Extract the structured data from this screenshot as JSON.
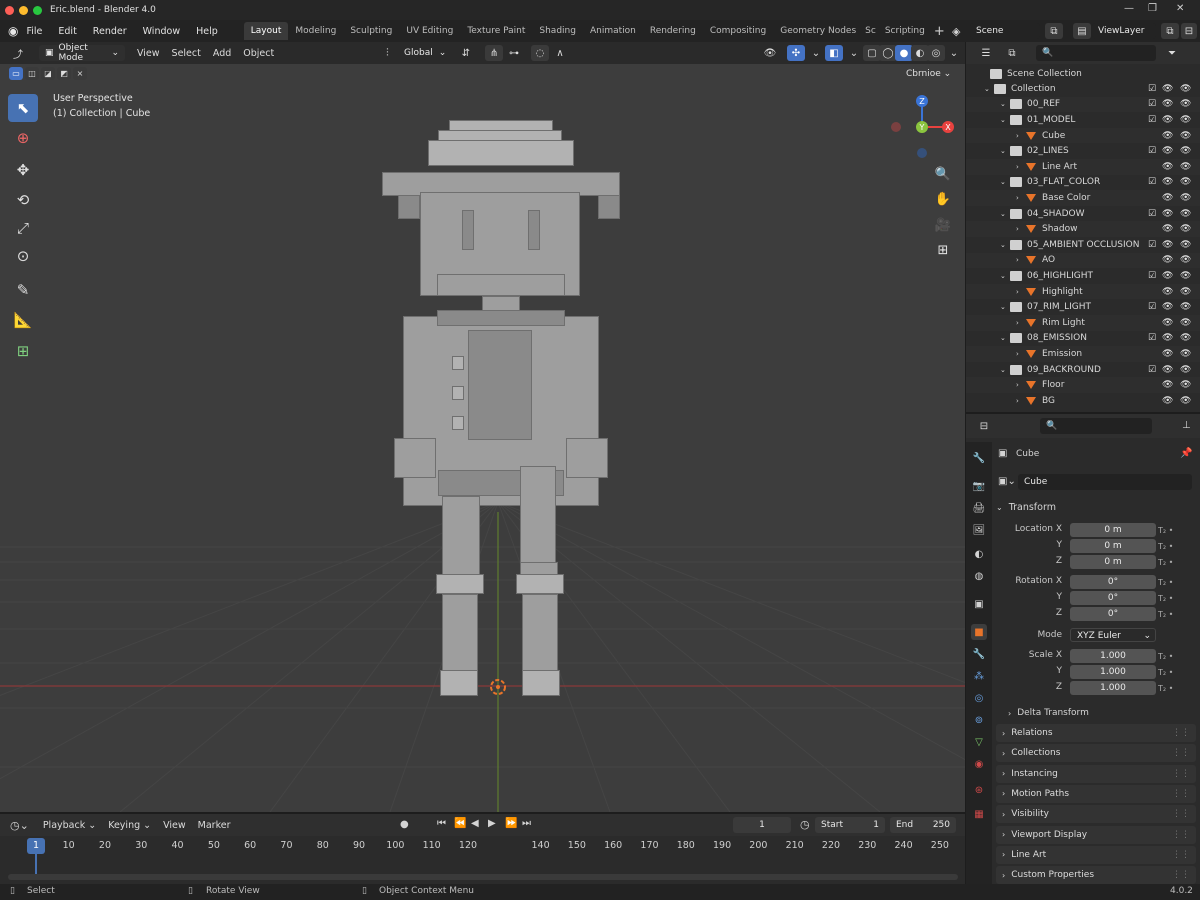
{
  "app": {
    "window_title": "Eric.blend - Blender 4.0",
    "version": "4.0.2"
  },
  "menu": [
    "File",
    "Edit",
    "Render",
    "Window",
    "Help"
  ],
  "workspaces": [
    "Layout",
    "Modeling",
    "Sculpting",
    "UV Editing",
    "Texture Paint",
    "Shading",
    "Animation",
    "Rendering",
    "Compositing",
    "Geometry Nodes",
    "Sc",
    "Scripting"
  ],
  "scene": {
    "name": "Scene",
    "view_layer": "ViewLayer"
  },
  "viewport_header": {
    "mode": "Object Mode",
    "menus": [
      "View",
      "Select",
      "Add",
      "Object"
    ],
    "orientation": "Global",
    "options_label": "Cbrnioe"
  },
  "viewport": {
    "perspective": "User Perspective",
    "info": "(1) Collection | Cube",
    "gizmo_labels": {
      "z": "Z",
      "x": "X",
      "y": "Y"
    }
  },
  "outliner": {
    "root": "Scene Collection",
    "rows": [
      {
        "label": "Collection",
        "kind": "collection",
        "depth": 0
      },
      {
        "label": "00_REF",
        "kind": "collection",
        "depth": 1
      },
      {
        "label": "01_MODEL",
        "kind": "collection",
        "depth": 1
      },
      {
        "label": "Cube",
        "kind": "object",
        "depth": 2
      },
      {
        "label": "02_LINES",
        "kind": "collection",
        "depth": 1
      },
      {
        "label": "Line Art",
        "kind": "object",
        "depth": 2
      },
      {
        "label": "03_FLAT_COLOR",
        "kind": "collection",
        "depth": 1
      },
      {
        "label": "Base Color",
        "kind": "object",
        "depth": 2
      },
      {
        "label": "04_SHADOW",
        "kind": "collection",
        "depth": 1
      },
      {
        "label": "Shadow",
        "kind": "object",
        "depth": 2
      },
      {
        "label": "05_AMBIENT OCCLUSION",
        "kind": "collection",
        "depth": 1
      },
      {
        "label": "AO",
        "kind": "object",
        "depth": 2
      },
      {
        "label": "06_HIGHLIGHT",
        "kind": "collection",
        "depth": 1
      },
      {
        "label": "Highlight",
        "kind": "object",
        "depth": 2
      },
      {
        "label": "07_RIM_LIGHT",
        "kind": "collection",
        "depth": 1
      },
      {
        "label": "Rim Light",
        "kind": "object",
        "depth": 2
      },
      {
        "label": "08_EMISSION",
        "kind": "collection",
        "depth": 1
      },
      {
        "label": "Emission",
        "kind": "object",
        "depth": 2
      },
      {
        "label": "09_BACKROUND",
        "kind": "collection",
        "depth": 1
      },
      {
        "label": "Floor",
        "kind": "object",
        "depth": 2
      },
      {
        "label": "BG",
        "kind": "object",
        "depth": 2
      }
    ]
  },
  "properties": {
    "object_name": "Cube",
    "data_name": "Cube",
    "transform_title": "Transform",
    "location": {
      "label": "Location X",
      "x": "0 m",
      "y": "0 m",
      "z": "0 m"
    },
    "rotation": {
      "label": "Rotation X",
      "x": "0°",
      "y": "0°",
      "z": "0°"
    },
    "mode": {
      "label": "Mode",
      "value": "XYZ Euler"
    },
    "scale": {
      "label": "Scale X",
      "x": "1.000",
      "y": "1.000",
      "z": "1.000"
    },
    "axis_labels": [
      "Y",
      "Z"
    ],
    "delta_transform": "Delta Transform",
    "panels": [
      "Relations",
      "Collections",
      "Instancing",
      "Motion Paths",
      "Visibility",
      "Viewport Display",
      "Line Art",
      "Custom Properties"
    ]
  },
  "timeline": {
    "menus": [
      "Playback",
      "Keying",
      "View",
      "Marker"
    ],
    "current_frame": "1",
    "start_label": "Start",
    "start": "1",
    "end_label": "End",
    "end": "250",
    "ticks": [
      "1",
      "10",
      "20",
      "30",
      "40",
      "50",
      "60",
      "70",
      "80",
      "90",
      "100",
      "110",
      "120",
      "140",
      "150",
      "160",
      "170",
      "180",
      "190",
      "200",
      "210",
      "220",
      "230",
      "240",
      "250"
    ]
  },
  "statusbar": {
    "select": "Select",
    "rotate": "Rotate View",
    "context": "Object Context Menu"
  },
  "colors": {
    "accent": "#4772b3",
    "object_orange": "#e8742a",
    "x_axis": "#e8423f",
    "y_axis": "#8bc53f",
    "z_axis": "#3a74d7"
  }
}
